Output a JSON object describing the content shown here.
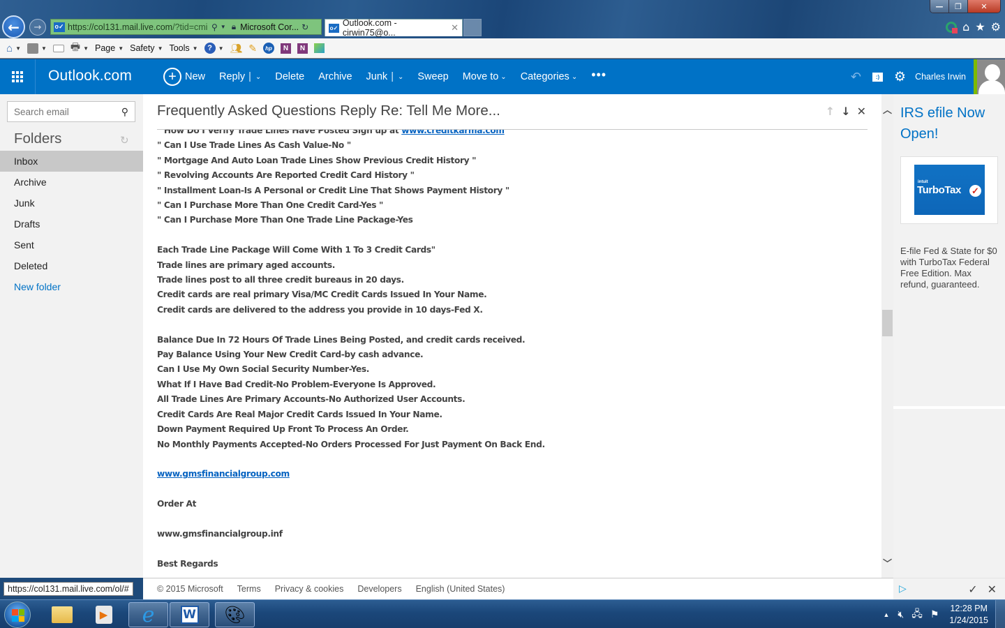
{
  "browser": {
    "address_url_main": "https://col131.mail.live.com",
    "address_url_rest": "/?tid=cmi",
    "certificate_label": "Microsoft Cor...",
    "active_tab_title": "Outlook.com - cirwin75@o...",
    "command_bar": {
      "page_label": "Page",
      "safety_label": "Safety",
      "tools_label": "Tools"
    },
    "status_url": "https://col131.mail.live.com/ol/#"
  },
  "outlook": {
    "brand": "Outlook.com",
    "commands": {
      "new": "New",
      "reply": "Reply",
      "delete": "Delete",
      "archive": "Archive",
      "junk": "Junk",
      "sweep": "Sweep",
      "move_to": "Move to",
      "categories": "Categories",
      "more": "•••"
    },
    "user_name": "Charles Irwin",
    "accent_color": "#0072c6"
  },
  "sidebar": {
    "search_placeholder": "Search email",
    "folders_title": "Folders",
    "folders": [
      {
        "label": "Inbox",
        "active": true
      },
      {
        "label": "Archive"
      },
      {
        "label": "Junk"
      },
      {
        "label": "Drafts"
      },
      {
        "label": "Sent"
      },
      {
        "label": "Deleted"
      }
    ],
    "new_folder_label": "New folder"
  },
  "message": {
    "subject": "Frequently Asked Questions Reply Re: Tell Me More...",
    "partial_first_line": "\" How Do I Verify Trade Lines Have Posted Sign up at ",
    "partial_first_link": "www.creditkarma.com",
    "faq_lines": [
      "\" Can I Use Trade Lines As Cash Value-No \"",
      "\" Mortgage And Auto Loan Trade Lines Show Previous Credit History \"",
      "\" Revolving Accounts Are Reported Credit Card History \"",
      "\" Installment Loan-Is A Personal or Credit Line That Shows Payment History \"",
      "\" Can I Purchase More Than One Credit Card-Yes \"",
      "\" Can I Purchase More Than One Trade Line Package-Yes"
    ],
    "package_lines": [
      "Each Trade Line Package Will Come With 1 To 3 Credit Cards\"",
      "Trade lines are primary aged accounts.",
      "Trade lines post to all three credit bureaus in 20 days.",
      "Credit cards are real primary Visa/MC Credit Cards Issued In Your Name.",
      "Credit cards are delivered to the address you provide in 10 days-Fed X."
    ],
    "balance_lines": [
      "Balance Due In 72 Hours Of Trade Lines Being Posted, and credit cards received.",
      "Pay Balance Using Your New Credit Card-by cash advance.",
      "Can I Use My Own Social Security Number-Yes.",
      "What If I Have Bad Credit-No Problem-Everyone Is Approved.",
      "All Trade Lines Are Primary Accounts-No Authorized User Accounts.",
      "Credit Cards Are Real Major Credit Cards Issued In Your Name.",
      "Down Payment Required Up Front To Process An Order.",
      "No Monthly Payments Accepted-No Orders Processed For Just Payment On Back End."
    ],
    "website_link": "www.gmsfinancialgroup.com",
    "order_at": "Order At",
    "order_site": "www.gmsfinancialgroup.inf",
    "signoff": "Best Regards"
  },
  "ad": {
    "title": "IRS efile Now Open!",
    "image_brand_small": "intuit",
    "image_brand": "TurboTax",
    "description": "E-file Fed & State for $0 with TurboTax Federal Free Edition. Max refund, guaranteed."
  },
  "footer": {
    "copyright": "© 2015 Microsoft",
    "terms": "Terms",
    "privacy": "Privacy & cookies",
    "developers": "Developers",
    "language": "English (United States)"
  },
  "taskbar": {
    "time": "12:28 PM",
    "date": "1/24/2015"
  }
}
